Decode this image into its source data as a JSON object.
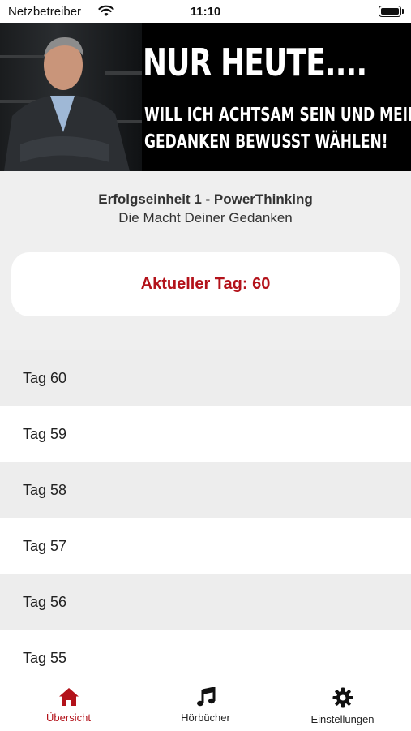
{
  "status": {
    "carrier": "Netzbetreiber",
    "time": "11:10"
  },
  "banner": {
    "headline": "NUR HEUTE....",
    "line1": "WILL ICH ACHTSAM SEIN UND MEINE",
    "line2": "GEDANKEN BEWUSST WÄHLEN!"
  },
  "unit": {
    "title": "Erfolgseinheit 1 - PowerThinking",
    "subtitle": "Die Macht Deiner Gedanken"
  },
  "current": {
    "label": "Aktueller Tag: 60"
  },
  "days": [
    "Tag 60",
    "Tag 59",
    "Tag 58",
    "Tag 57",
    "Tag 56",
    "Tag 55"
  ],
  "tabs": [
    {
      "label": "Übersicht",
      "icon": "home-icon",
      "active": true
    },
    {
      "label": "Hörbücher",
      "icon": "music-note-icon",
      "active": false
    },
    {
      "label": "Einstellungen",
      "icon": "gear-icon",
      "active": false
    }
  ],
  "colors": {
    "accent": "#b3121a",
    "background": "#efefef"
  }
}
